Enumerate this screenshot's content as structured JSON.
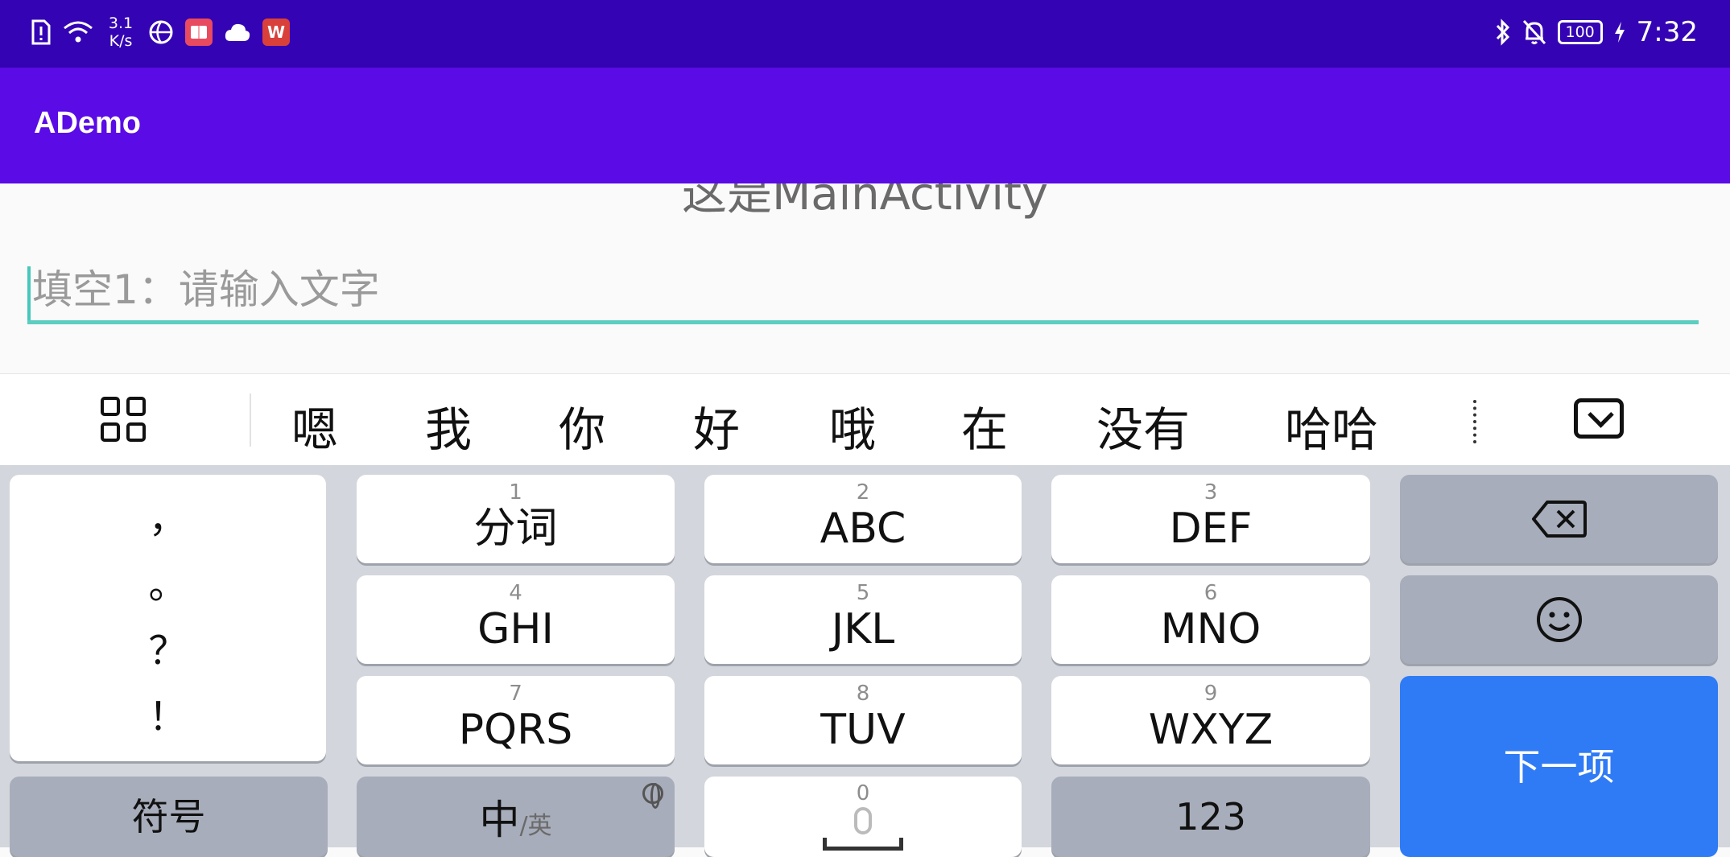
{
  "status_bar": {
    "network_speed_value": "3.1",
    "network_speed_unit": "K/s",
    "battery_level": "100",
    "time": "7:32"
  },
  "app_bar": {
    "title": "ADemo"
  },
  "main": {
    "label": "这是MainActivity",
    "input_placeholder": "填空1：请输入文字",
    "input_value": ""
  },
  "candidates": [
    "嗯",
    "我",
    "你",
    "好",
    "哦",
    "在",
    "没有",
    "哈哈"
  ],
  "keyboard": {
    "punct": [
      "，",
      "。",
      "？",
      "！"
    ],
    "keys": [
      {
        "num": "1",
        "label": "分词"
      },
      {
        "num": "2",
        "label": "ABC"
      },
      {
        "num": "3",
        "label": "DEF"
      },
      {
        "num": "4",
        "label": "GHI"
      },
      {
        "num": "5",
        "label": "JKL"
      },
      {
        "num": "6",
        "label": "MNO"
      },
      {
        "num": "7",
        "label": "PQRS"
      },
      {
        "num": "8",
        "label": "TUV"
      },
      {
        "num": "9",
        "label": "WXYZ"
      }
    ],
    "symbol_label": "符号",
    "lang_main": "中",
    "lang_alt": "/英",
    "space_num": "0",
    "num_label": "123",
    "next_label": "下一项"
  },
  "colors": {
    "status_bar": "#3404b4",
    "app_bar": "#5a0be6",
    "accent": "#5ccdc0",
    "next_key": "#2f7bf5"
  }
}
